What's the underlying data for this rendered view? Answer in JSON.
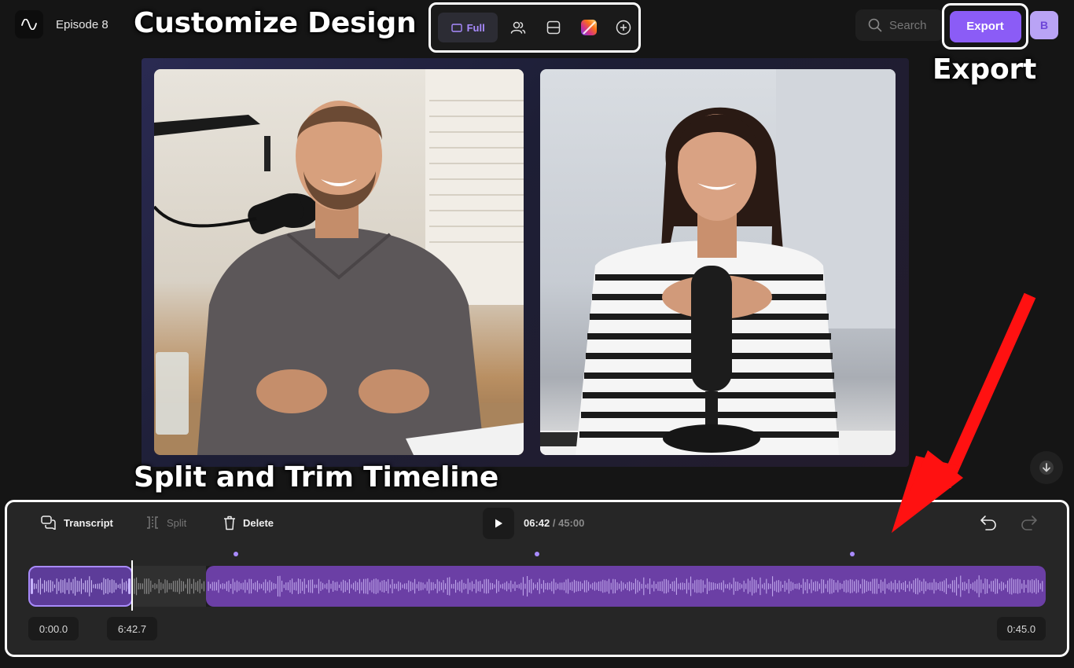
{
  "header": {
    "logo_icon": "waveform-logo-icon",
    "episode_title": "Episode 8"
  },
  "annotations": {
    "customize_design": "Customize Design",
    "export": "Export",
    "split_trim": "Split and Trim Timeline"
  },
  "layout_toolbar": {
    "items": [
      {
        "icon": "full-layout-icon",
        "label": "Full",
        "active": true
      },
      {
        "icon": "speakers-layout-icon"
      },
      {
        "icon": "split-layout-icon"
      },
      {
        "icon": "gradient-background-icon"
      },
      {
        "icon": "add-icon"
      }
    ]
  },
  "search": {
    "placeholder": "Search",
    "icon": "search-icon"
  },
  "export_button": {
    "label": "Export",
    "color": "#8b5cf6"
  },
  "user": {
    "avatar_initial": "B"
  },
  "timeline": {
    "tools": {
      "transcript": "Transcript",
      "split": "Split",
      "delete": "Delete"
    },
    "playback": {
      "current_time": "06:42",
      "separator": " / ",
      "total_time": "45:00"
    },
    "time_chips": {
      "start": "0:00.0",
      "playhead": "6:42.7",
      "end": "0:45.0"
    },
    "accent_color": "#a98bff",
    "trim_color": "#6b3fa5"
  }
}
